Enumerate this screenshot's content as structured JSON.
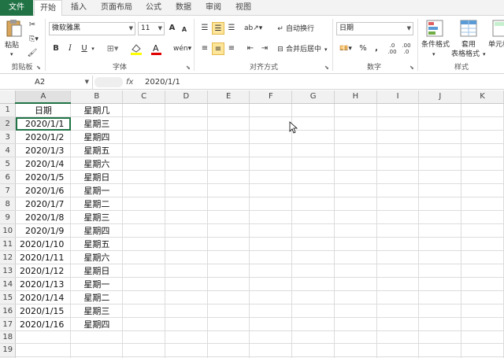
{
  "tabs": [
    {
      "label": "文件"
    },
    {
      "label": "开始"
    },
    {
      "label": "插入"
    },
    {
      "label": "页面布局"
    },
    {
      "label": "公式"
    },
    {
      "label": "数据"
    },
    {
      "label": "审阅"
    },
    {
      "label": "视图"
    }
  ],
  "clipboard": {
    "paste_label": "粘贴",
    "group_label": "剪贴板"
  },
  "font": {
    "name": "微软雅黑",
    "size": "11",
    "bold": "B",
    "italic": "I",
    "underline": "U",
    "group_label": "字体",
    "grow": "A",
    "shrink": "A"
  },
  "align": {
    "wrap_label": "自动换行",
    "merge_label": "合并后居中",
    "group_label": "对齐方式"
  },
  "number": {
    "format": "日期",
    "percent": "%",
    "comma": ",",
    "group_label": "数字"
  },
  "styles": {
    "cond_label": "条件格式",
    "table_label_1": "套用",
    "table_label_2": "表格格式",
    "cell_label": "单元格",
    "group_label": "样式"
  },
  "formula_bar": {
    "name_box": "A2",
    "fx": "fx",
    "value": "2020/1/1"
  },
  "columns": [
    "A",
    "B",
    "C",
    "D",
    "E",
    "F",
    "G",
    "H",
    "I",
    "J",
    "K"
  ],
  "rows": [
    {
      "n": "1",
      "a": "日期",
      "b": "星期几"
    },
    {
      "n": "2",
      "a": "2020/1/1",
      "b": "星期三"
    },
    {
      "n": "3",
      "a": "2020/1/2",
      "b": "星期四"
    },
    {
      "n": "4",
      "a": "2020/1/3",
      "b": "星期五"
    },
    {
      "n": "5",
      "a": "2020/1/4",
      "b": "星期六"
    },
    {
      "n": "6",
      "a": "2020/1/5",
      "b": "星期日"
    },
    {
      "n": "7",
      "a": "2020/1/6",
      "b": "星期一"
    },
    {
      "n": "8",
      "a": "2020/1/7",
      "b": "星期二"
    },
    {
      "n": "9",
      "a": "2020/1/8",
      "b": "星期三"
    },
    {
      "n": "10",
      "a": "2020/1/9",
      "b": "星期四"
    },
    {
      "n": "11",
      "a": "2020/1/10",
      "b": "星期五"
    },
    {
      "n": "12",
      "a": "2020/1/11",
      "b": "星期六"
    },
    {
      "n": "13",
      "a": "2020/1/12",
      "b": "星期日"
    },
    {
      "n": "14",
      "a": "2020/1/13",
      "b": "星期一"
    },
    {
      "n": "15",
      "a": "2020/1/14",
      "b": "星期二"
    },
    {
      "n": "16",
      "a": "2020/1/15",
      "b": "星期三"
    },
    {
      "n": "17",
      "a": "2020/1/16",
      "b": "星期四"
    },
    {
      "n": "18",
      "a": "",
      "b": ""
    },
    {
      "n": "19",
      "a": "",
      "b": ""
    },
    {
      "n": "20",
      "a": "",
      "b": ""
    }
  ],
  "colors": {
    "accent": "#217346",
    "selected_button": "#fde59a"
  }
}
